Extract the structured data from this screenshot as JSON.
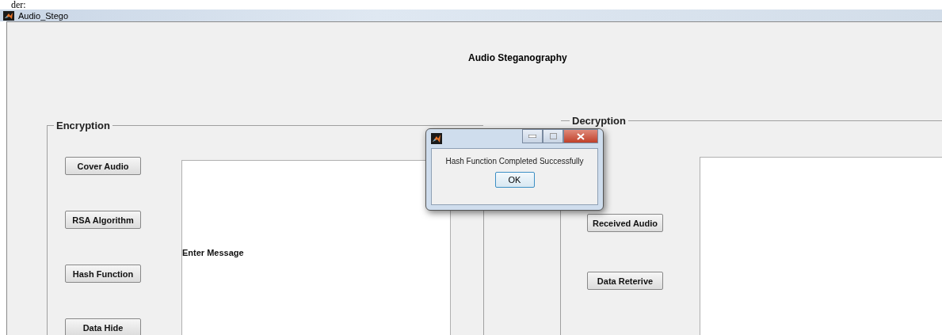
{
  "page_fragment": "der:",
  "window": {
    "title": "Audio_Stego"
  },
  "heading": "Audio Steganography",
  "encryption": {
    "title": "Encryption",
    "buttons": [
      "Cover Audio",
      "RSA Algorithm",
      "Hash Function",
      "Data Hide"
    ],
    "message_label": "Enter Message"
  },
  "decryption": {
    "title": "Decryption",
    "buttons": [
      "Received Audio",
      "Data Reterive"
    ]
  },
  "dialog": {
    "message": "Hash Function Completed Successfully",
    "button": "OK"
  }
}
